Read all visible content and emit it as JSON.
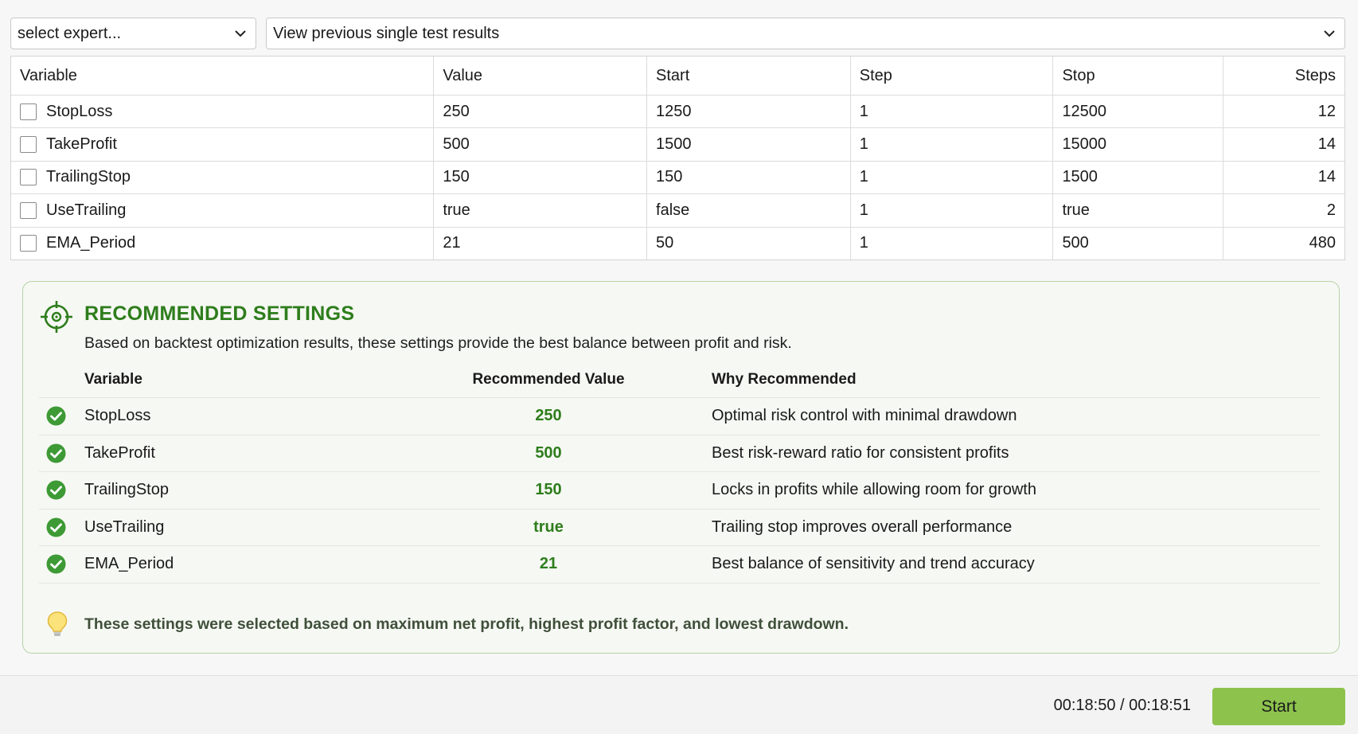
{
  "toolbar": {
    "expert_select": "select expert...",
    "results_select": "View previous single test results"
  },
  "variables": {
    "headers": [
      "Variable",
      "Value",
      "Start",
      "Step",
      "Stop",
      "Steps"
    ],
    "rows": [
      {
        "name": "StopLoss",
        "value": "250",
        "start": "1250",
        "step": "1",
        "stop": "12500",
        "steps": "12"
      },
      {
        "name": "TakeProfit",
        "value": "500",
        "start": "1500",
        "step": "1",
        "stop": "15000",
        "steps": "14"
      },
      {
        "name": "TrailingStop",
        "value": "150",
        "start": "150",
        "step": "1",
        "stop": "1500",
        "steps": "14"
      },
      {
        "name": "UseTrailing",
        "value": "true",
        "start": "false",
        "step": "1",
        "stop": "true",
        "steps": "2"
      },
      {
        "name": "EMA_Period",
        "value": "21",
        "start": "50",
        "step": "1",
        "stop": "500",
        "steps": "480"
      }
    ]
  },
  "recommended": {
    "title": "RECOMMENDED SETTINGS",
    "description": "Based on backtest optimization results, these settings provide the best balance between profit and risk.",
    "headers": [
      "Variable",
      "Recommended Value",
      "Why Recommended"
    ],
    "rows": [
      {
        "name": "StopLoss",
        "value": "250",
        "why": "Optimal risk control with minimal drawdown"
      },
      {
        "name": "TakeProfit",
        "value": "500",
        "why": "Best risk-reward ratio for consistent profits"
      },
      {
        "name": "TrailingStop",
        "value": "150",
        "why": "Locks in profits while allowing room for growth"
      },
      {
        "name": "UseTrailing",
        "value": "true",
        "why": "Trailing stop improves overall performance"
      },
      {
        "name": "EMA_Period",
        "value": "21",
        "why": "Best balance of sensitivity and trend accuracy"
      }
    ],
    "note": "These settings were selected based on maximum net profit, highest profit factor, and lowest drawdown.",
    "accent_color": "#2e7d1c",
    "check_color": "#3d9a35"
  },
  "footer": {
    "timer": "00:18:50 / 00:18:51",
    "start_label": "Start",
    "start_color": "#8dc24d"
  },
  "icons": {
    "select_chevron": "chevron-down-icon",
    "recommended": "crosshair-target-icon",
    "row_check": "check-circle-icon",
    "note": "lightbulb-icon"
  }
}
